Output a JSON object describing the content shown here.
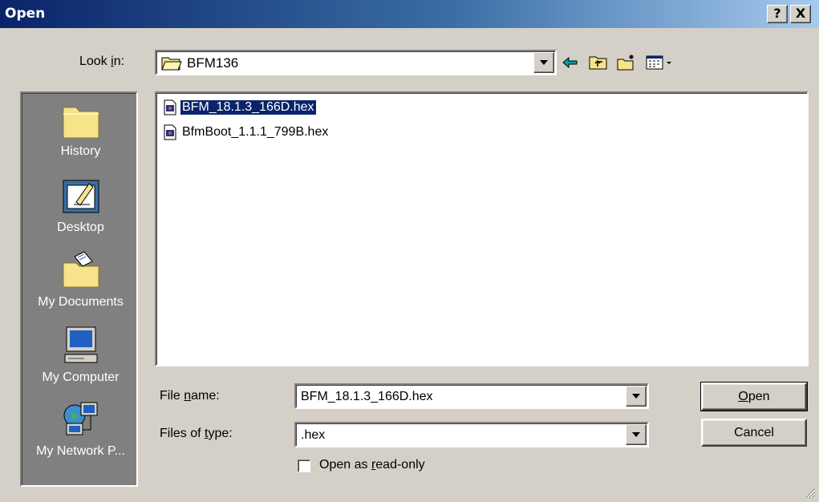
{
  "window": {
    "title": "Open",
    "help_label": "?",
    "close_label": "X"
  },
  "lookin": {
    "label_pre": "Look ",
    "label_key": "i",
    "label_post": "n:",
    "value": "BFM136",
    "toolbar": [
      "back-arrow-icon",
      "up-folder-icon",
      "new-folder-icon",
      "view-menu-icon"
    ]
  },
  "places": [
    {
      "label": "History",
      "icon": "history-folder-icon"
    },
    {
      "label": "Desktop",
      "icon": "desktop-icon"
    },
    {
      "label": "My Documents",
      "icon": "my-documents-icon"
    },
    {
      "label": "My Computer",
      "icon": "my-computer-icon"
    },
    {
      "label": "My Network P...",
      "icon": "network-places-icon"
    }
  ],
  "files": [
    {
      "name": "BFM_18.1.3_166D.hex",
      "selected": true
    },
    {
      "name": "BfmBoot_1.1.1_799B.hex",
      "selected": false
    }
  ],
  "filename": {
    "label_pre": "File ",
    "label_key": "n",
    "label_post": "ame:",
    "value": "BFM_18.1.3_166D.hex"
  },
  "filetype": {
    "label_pre": "Files of ",
    "label_key": "t",
    "label_post": "ype:",
    "value": ".hex"
  },
  "readonly": {
    "label_pre": "Open as ",
    "label_key": "r",
    "label_post": "ead-only",
    "checked": false
  },
  "buttons": {
    "open_key": "O",
    "open_rest": "pen",
    "cancel": "Cancel"
  },
  "colors": {
    "titlebar_start": "#0a246a",
    "titlebar_end": "#a6caf0",
    "face": "#d4d0c8",
    "selection": "#0a246a"
  }
}
